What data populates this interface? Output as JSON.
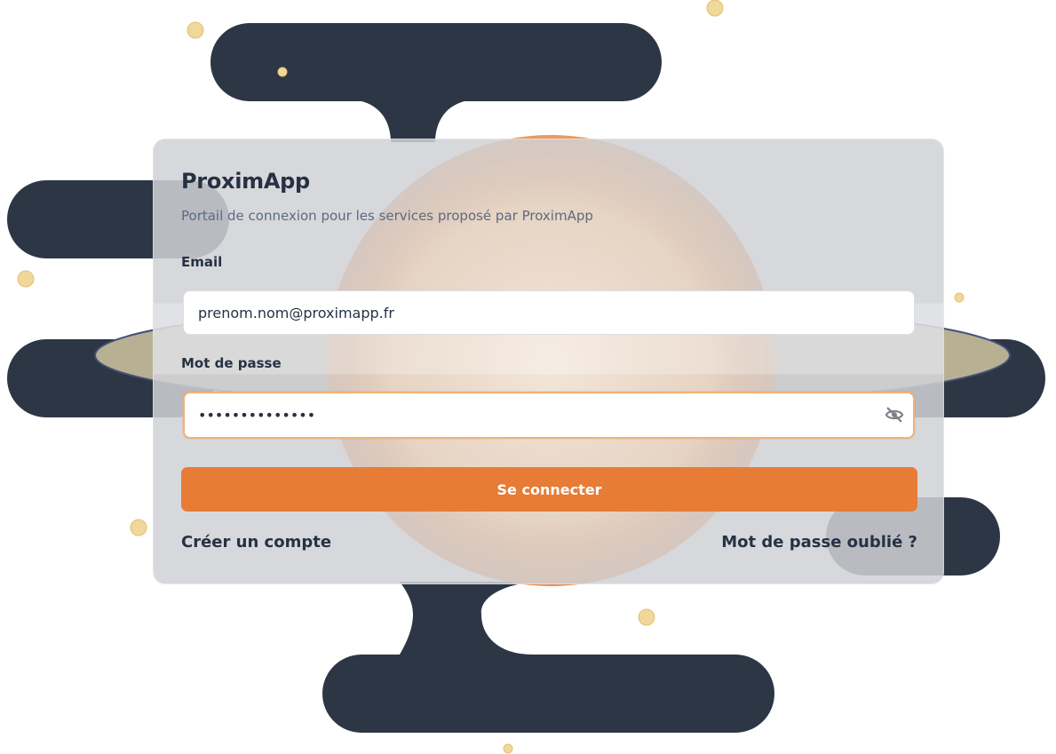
{
  "app": {
    "title": "ProximApp",
    "subtitle": "Portail de connexion pour les services proposé par ProximApp"
  },
  "form": {
    "email_label": "Email",
    "email_value": "prenom.nom@proximapp.fr",
    "password_label": "Mot de passe",
    "password_value": "••••••••••••••",
    "submit_label": "Se connecter"
  },
  "links": {
    "create_account": "Créer un compte",
    "forgot_password": "Mot de passe oublié ?"
  },
  "icons": {
    "password_toggle": "eye-off-icon"
  },
  "colors": {
    "accent": "#e67c35",
    "dark_shape": "#2d3644",
    "planet_ring": "#b7b092",
    "dot": "#f0d79a",
    "text_primary": "#263243",
    "text_secondary": "#5b6b80"
  }
}
